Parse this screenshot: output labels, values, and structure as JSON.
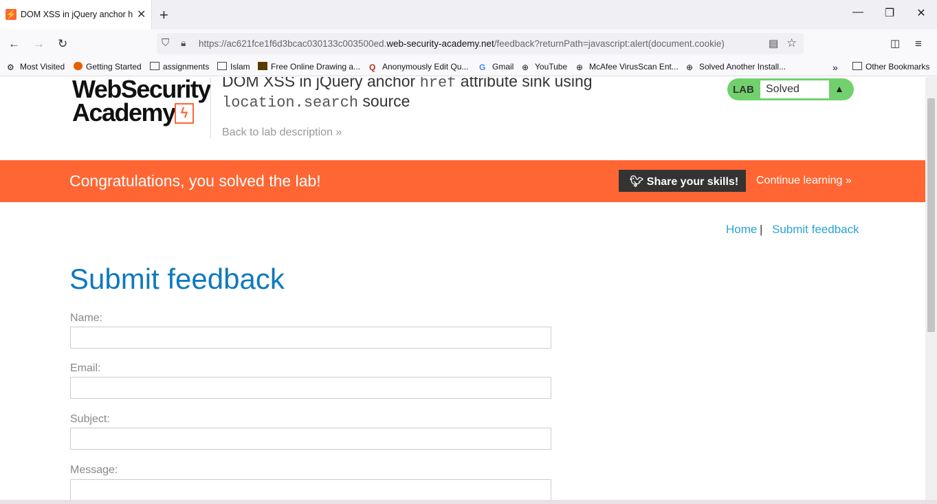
{
  "browser": {
    "tab_title": "DOM XSS in jQuery anchor href",
    "tab_close": "✕",
    "new_tab": "+",
    "url_prefix": "https://ac621fce1f6d3bcac030133c003500ed.",
    "url_domain": "web-security-academy.net",
    "url_path": "/feedback?returnPath=javascript:alert(document.cookie)",
    "bookmarks": [
      "Most Visited",
      "Getting Started",
      "assignments",
      "Islam",
      "Free Online Drawing a...",
      "Anonymously Edit Qu...",
      "Gmail",
      "YouTube",
      "McAfee VirusScan Ent...",
      "Solved Another Install...",
      "Other Bookmarks"
    ]
  },
  "header": {
    "logo_line1": "WebSecurity",
    "logo_line2": "Academy",
    "lab_title_1": "DOM XSS in jQuery anchor ",
    "lab_title_code1": "href",
    "lab_title_2": " attribute sink using",
    "lab_title_code2": "location.search",
    "lab_title_3": " source",
    "back_link": "Back to lab description »",
    "badge_lab": "LAB",
    "badge_status": "Solved"
  },
  "banner": {
    "message": "Congratulations, you solved the lab!",
    "share": "Share your skills!",
    "continue": "Continue learning »"
  },
  "nav": {
    "home": "Home",
    "separator": "|",
    "submit_feedback": "Submit feedback"
  },
  "form": {
    "heading": "Submit feedback",
    "name_label": "Name:",
    "email_label": "Email:",
    "subject_label": "Subject:",
    "message_label": "Message:"
  },
  "colors": {
    "accent": "#ff6633",
    "link": "#29a3d3",
    "heading": "#0f79bf",
    "solved": "#70d16d"
  }
}
